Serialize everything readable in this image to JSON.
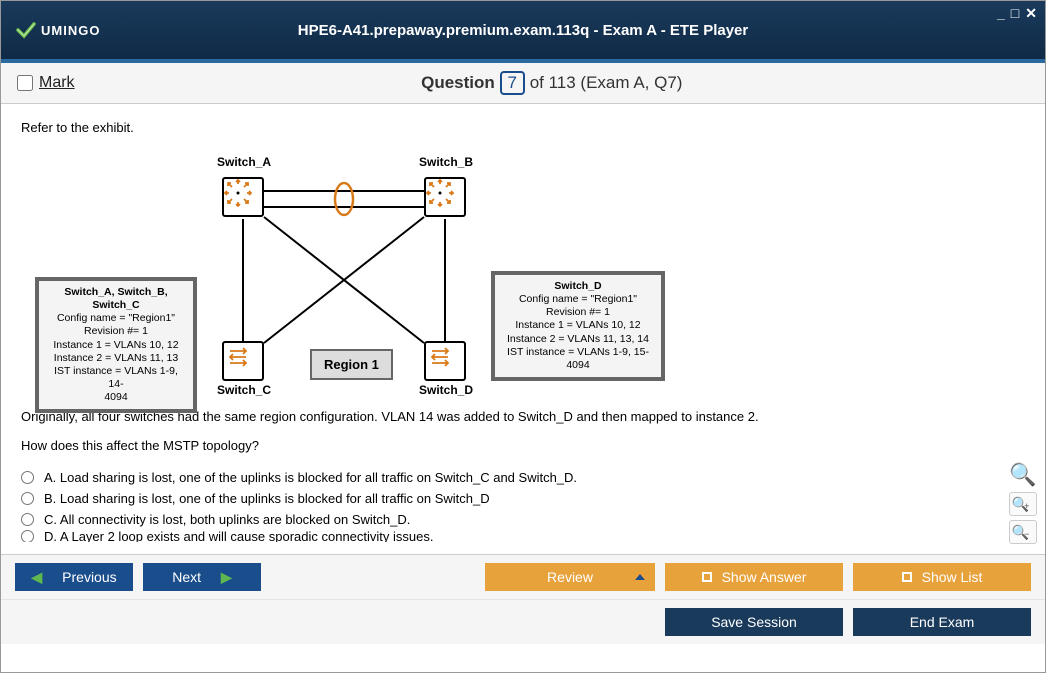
{
  "window": {
    "brand": "UMINGO",
    "title": "HPE6-A41.prepaway.premium.exam.113q - Exam A - ETE Player"
  },
  "header": {
    "mark_label": "Mark",
    "question_word": "Question",
    "question_num": "7",
    "of_text": "of 113 (Exam A, Q7)"
  },
  "question": {
    "intro": "Refer to the exhibit.",
    "body1": "Originally, all four switches had the same region configuration. VLAN 14 was added to Switch_D and then mapped to instance 2.",
    "body2": "How does this affect the MSTP topology?",
    "diagram": {
      "switch_a": "Switch_A",
      "switch_b": "Switch_B",
      "switch_c": "Switch_C",
      "switch_d": "Switch_D",
      "region": "Region 1",
      "box_left_title": "Switch_A, Switch_B, Switch_C",
      "box_left_l1": "Config name = \"Region1\"",
      "box_left_l2": "Revision #= 1",
      "box_left_l3": "Instance 1 = VLANs 10, 12",
      "box_left_l4": "Instance 2 = VLANs 11, 13",
      "box_left_l5": "IST instance = VLANs 1-9, 14-",
      "box_left_l6": "4094",
      "box_right_title": "Switch_D",
      "box_right_l1": "Config name = \"Region1\"",
      "box_right_l2": "Revision #= 1",
      "box_right_l3": "Instance 1 = VLANs 10, 12",
      "box_right_l4": "Instance 2 = VLANs 11, 13, 14",
      "box_right_l5": "IST instance = VLANs 1-9, 15-",
      "box_right_l6": "4094"
    },
    "options": {
      "a": "A.  Load sharing is lost, one of the uplinks is blocked for all traffic on Switch_C and Switch_D.",
      "b": "B.  Load sharing is lost, one of the uplinks is blocked for all traffic on Switch_D",
      "c": "C.  All connectivity is lost, both uplinks are blocked on Switch_D.",
      "d": "D.  A Layer 2 loop exists and will cause sporadic connectivity issues."
    }
  },
  "footer": {
    "previous": "Previous",
    "next": "Next",
    "review": "Review",
    "show_answer": "Show Answer",
    "show_list": "Show List",
    "save_session": "Save Session",
    "end_exam": "End Exam"
  }
}
